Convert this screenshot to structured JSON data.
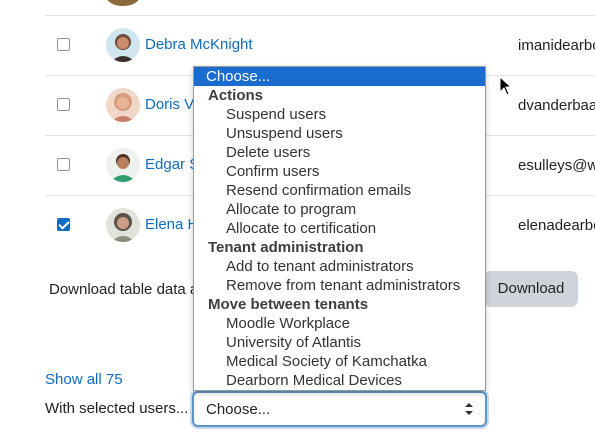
{
  "users": [
    {
      "name": "Debra McKnight",
      "email": "imanidearbo",
      "checked": false,
      "avatar_color": "#6b4a3a"
    },
    {
      "name": "Doris Vo",
      "email": "dvanderbaa",
      "checked": false,
      "avatar_color": "#d79a7c"
    },
    {
      "name": "Edgar S",
      "email": "esulleys@w",
      "checked": false,
      "avatar_color": "#2f9d6e"
    },
    {
      "name": "Elena H",
      "email": "elenadearbo",
      "checked": true,
      "avatar_color": "#5a5347"
    }
  ],
  "download": {
    "label": "Download table data a",
    "button": "Download"
  },
  "show_all": "Show all 75",
  "with_selected": {
    "label": "With selected users...",
    "value": "Choose..."
  },
  "dropdown": {
    "selected": "Choose...",
    "groups": [
      {
        "label": "Actions",
        "items": [
          "Suspend users",
          "Unsuspend users",
          "Delete users",
          "Confirm users",
          "Resend confirmation emails",
          "Allocate to program",
          "Allocate to certification"
        ]
      },
      {
        "label": "Tenant administration",
        "items": [
          "Add to tenant administrators",
          "Remove from tenant administrators"
        ]
      },
      {
        "label": "Move between tenants",
        "items": [
          "Moodle Workplace",
          "University of Atlantis",
          "Medical Society of Kamchatka",
          "Dearborn Medical Devices"
        ]
      }
    ]
  },
  "colors": {
    "link": "#0f6cbf",
    "selected_option": "#1a6dcf",
    "button_bg": "#ced4da"
  }
}
